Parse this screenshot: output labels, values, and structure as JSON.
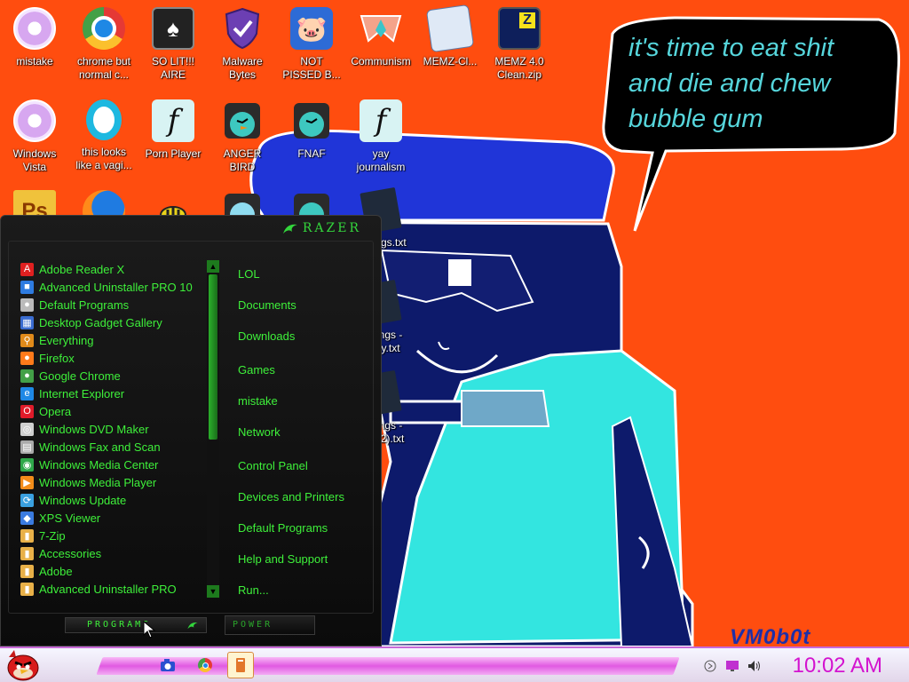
{
  "desktop": {
    "speech_bubble": [
      "it's time to eat shit",
      "and die and chew",
      "bubble gum"
    ],
    "signature": "VM0b0t",
    "icons": [
      {
        "label": "mistake",
        "icon": "purple-disc-icon"
      },
      {
        "label": "chrome but\nnormal c...",
        "icon": "chrome-icon"
      },
      {
        "label": "SO LIT!!!\nAIRE",
        "icon": "playing-cards-icon"
      },
      {
        "label": "Malware\nBytes",
        "icon": "shield-icon"
      },
      {
        "label": "NOT\nPISSED B...",
        "icon": "pig-icon"
      },
      {
        "label": "Communism",
        "icon": "communism-icon"
      },
      {
        "label": "MEMZ-Cl...",
        "icon": "memz-icon"
      },
      {
        "label": "MEMZ 4.0\nClean.zip",
        "icon": "zip-icon"
      },
      {
        "label": "Windows\nVista",
        "icon": "purple-disc-icon"
      },
      {
        "label": "this looks\nlike a vagi...",
        "icon": "opera-icon"
      },
      {
        "label": "Porn Player",
        "icon": "flash-icon"
      },
      {
        "label": "ANGER\nBIRD",
        "icon": "bird-icon"
      },
      {
        "label": "FNAF",
        "icon": "bird-icon"
      },
      {
        "label": "yay\njournalism",
        "icon": "flash-icon"
      }
    ],
    "partial_icons": [
      "photoshop-icon",
      "firefox-icon",
      "wasp-icon",
      "bird-icon",
      "bird-icon",
      "text-file-icon"
    ],
    "partial_file_labels": [
      "ngs.txt",
      "ngs -\ny.txt",
      "ngs -\n(2).txt"
    ]
  },
  "start_menu": {
    "brand": "RAZER",
    "programs": [
      {
        "label": "Adobe Reader X",
        "icon": "adobe-reader-icon",
        "color": "#e02020"
      },
      {
        "label": "Advanced Uninstaller PRO 10",
        "icon": "uninstaller-icon",
        "color": "#2e7be0"
      },
      {
        "label": "Default Programs",
        "icon": "default-programs-icon",
        "color": "#bbbbbb"
      },
      {
        "label": "Desktop Gadget Gallery",
        "icon": "gadget-icon",
        "color": "#3a6cd0"
      },
      {
        "label": "Everything",
        "icon": "magnifier-icon",
        "color": "#e08a1a"
      },
      {
        "label": "Firefox",
        "icon": "firefox-icon",
        "color": "#ff7a1a"
      },
      {
        "label": "Google Chrome",
        "icon": "chrome-icon",
        "color": "#43a047"
      },
      {
        "label": "Internet Explorer",
        "icon": "ie-icon",
        "color": "#1e88e5"
      },
      {
        "label": "Opera",
        "icon": "opera-icon",
        "color": "#e01b2a"
      },
      {
        "label": "Windows DVD Maker",
        "icon": "dvd-icon",
        "color": "#cfcfcf"
      },
      {
        "label": "Windows Fax and Scan",
        "icon": "fax-icon",
        "color": "#aaaaaa"
      },
      {
        "label": "Windows Media Center",
        "icon": "media-center-icon",
        "color": "#2fa84a"
      },
      {
        "label": "Windows Media Player",
        "icon": "media-player-icon",
        "color": "#f28c1a"
      },
      {
        "label": "Windows Update",
        "icon": "windows-update-icon",
        "color": "#3aa0e0"
      },
      {
        "label": "XPS Viewer",
        "icon": "xps-icon",
        "color": "#3a7be0"
      },
      {
        "label": "7-Zip",
        "icon": "folder-icon",
        "color": "#e8b048"
      },
      {
        "label": "Accessories",
        "icon": "folder-icon",
        "color": "#e8b048"
      },
      {
        "label": "Adobe",
        "icon": "folder-icon",
        "color": "#e8b048"
      },
      {
        "label": "Advanced Uninstaller PRO",
        "icon": "folder-icon",
        "color": "#e8b048"
      }
    ],
    "places": [
      "LOL",
      "Documents",
      "Downloads",
      "Games",
      "mistake",
      "Network",
      "Control Panel",
      "Devices and Printers",
      "Default Programs",
      "Help and Support",
      "Run..."
    ],
    "programs_button": "PROGRAMS",
    "power_button": "POWER"
  },
  "taskbar": {
    "clock": "10:02 AM",
    "pinned": [
      "camera-icon",
      "chrome-icon",
      "book-icon"
    ],
    "tray": [
      "action-center-icon",
      "monitor-icon",
      "volume-icon"
    ]
  },
  "colors": {
    "wallpaper": "#ff4d0f",
    "menu_text": "#3ef03a",
    "clock": "#d313cf",
    "speech_text": "#56d6dc"
  }
}
